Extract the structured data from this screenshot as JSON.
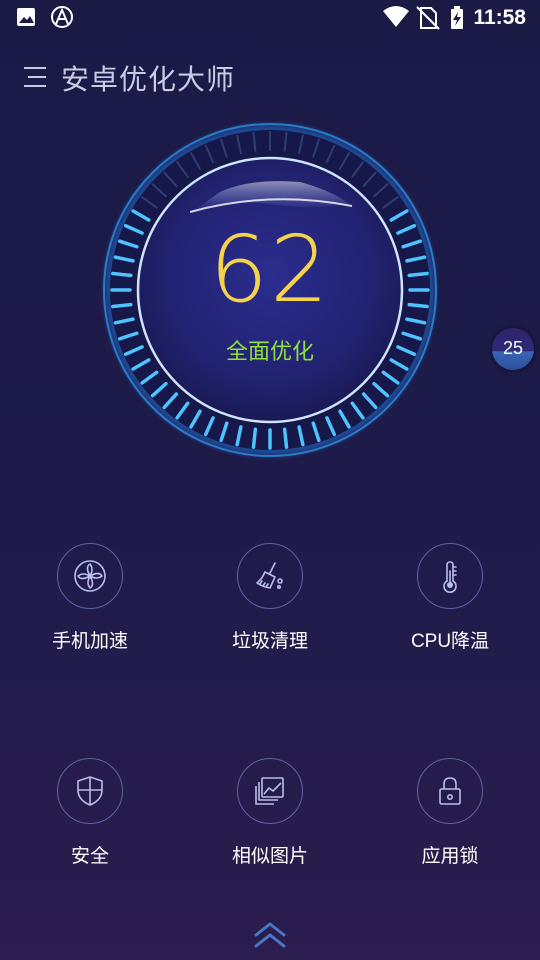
{
  "status_bar": {
    "time": "11:58",
    "left_icons": [
      "image-notification-icon",
      "app-notification-icon"
    ],
    "right_icons": [
      "wifi-icon",
      "no-sim-icon",
      "battery-charging-icon"
    ]
  },
  "header": {
    "menu_icon": "menu-icon",
    "title": "安卓优化大师"
  },
  "gauge": {
    "score": "62",
    "action_label": "全面优化",
    "score_color": "#f4d24a",
    "action_color": "#8ee13a",
    "ring_color": "#4fc3ff"
  },
  "floating_badge": {
    "value": "25"
  },
  "features": [
    {
      "label": "手机加速",
      "icon": "fan-icon"
    },
    {
      "label": "垃圾清理",
      "icon": "broom-icon"
    },
    {
      "label": "CPU降温",
      "icon": "thermometer-icon"
    },
    {
      "label": "安全",
      "icon": "shield-icon"
    },
    {
      "label": "相似图片",
      "icon": "photos-icon"
    },
    {
      "label": "应用锁",
      "icon": "lock-icon"
    }
  ],
  "bottom": {
    "icon": "double-chevron-up-icon"
  },
  "colors": {
    "background": "#1d1b48",
    "icon_stroke": "#b9bfe6",
    "circle_border": "#5e63a3"
  }
}
